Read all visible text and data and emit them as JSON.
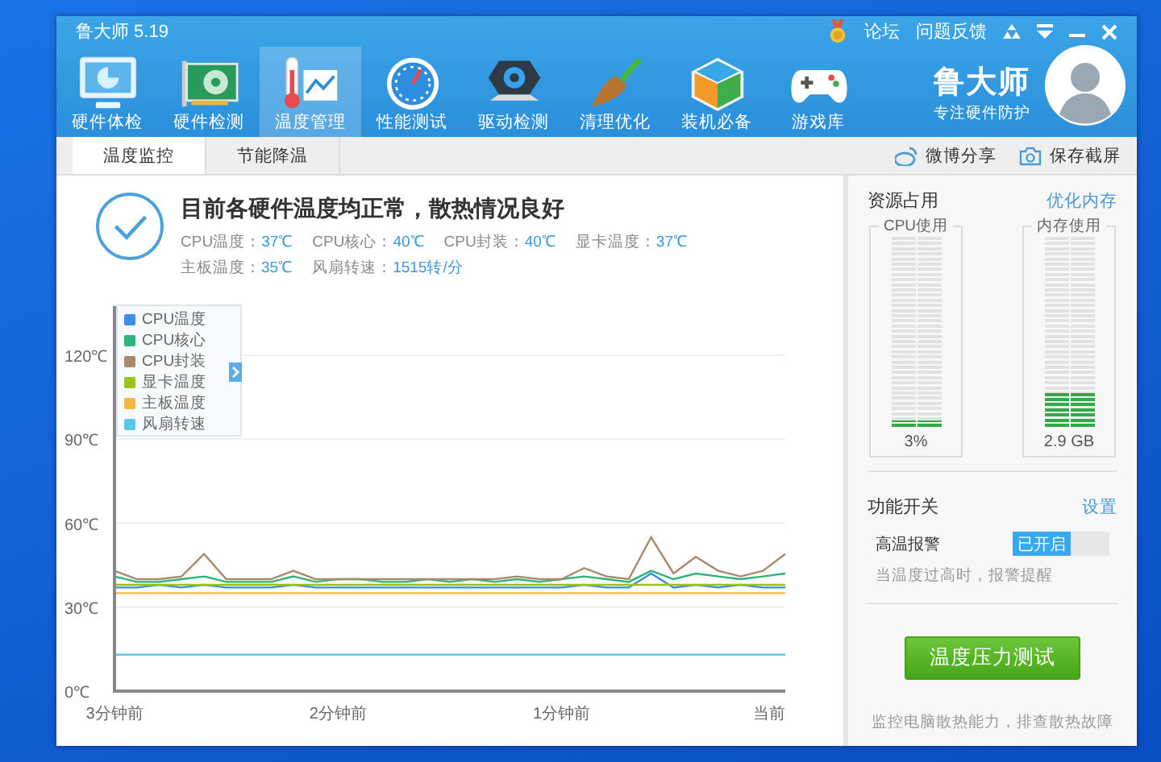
{
  "window": {
    "title": "鲁大师 5.19"
  },
  "title_bar": {
    "links": [
      "论坛",
      "问题反馈"
    ]
  },
  "nav": [
    {
      "label": "硬件体检",
      "selected": false
    },
    {
      "label": "硬件检测",
      "selected": false
    },
    {
      "label": "温度管理",
      "selected": true
    },
    {
      "label": "性能测试",
      "selected": false
    },
    {
      "label": "驱动检测",
      "selected": false
    },
    {
      "label": "清理优化",
      "selected": false
    },
    {
      "label": "装机必备",
      "selected": false
    },
    {
      "label": "游戏库",
      "selected": false
    }
  ],
  "brand": {
    "name": "鲁大师",
    "slogan": "专注硬件防护"
  },
  "subtabs": [
    {
      "label": "温度监控",
      "selected": true
    },
    {
      "label": "节能降温",
      "selected": false
    }
  ],
  "actions": [
    "微博分享",
    "保存截屏"
  ],
  "status": {
    "headline": "目前各硬件温度均正常，散热情况良好",
    "readings": [
      [
        {
          "label": "CPU温度：",
          "value": "37℃"
        },
        {
          "label": "CPU核心：",
          "value": "40℃"
        },
        {
          "label": "CPU封装：",
          "value": "40℃"
        },
        {
          "label": "显卡温度：",
          "value": "37℃"
        }
      ],
      [
        {
          "label": "主板温度：",
          "value": "35℃"
        },
        {
          "label": "风扇转速：",
          "value": "1515转/分"
        }
      ]
    ]
  },
  "chart_data": {
    "type": "line",
    "grid": true,
    "legend": "upper left",
    "x": [
      3,
      2.9,
      2.8,
      2.7,
      2.6,
      2.5,
      2.4,
      2.3,
      2.2,
      2.1,
      2,
      1.9,
      1.8,
      1.7,
      1.6,
      1.5,
      1.4,
      1.3,
      1.2,
      1.1,
      1,
      0.9,
      0.8,
      0.7,
      0.6,
      0.5,
      0.4,
      0.3,
      0.2,
      0.1,
      0
    ],
    "xlim": [
      3,
      0
    ],
    "xticks": [
      {
        "value": 3,
        "label": "3分钟前"
      },
      {
        "value": 2,
        "label": "2分钟前"
      },
      {
        "value": 1,
        "label": "1分钟前"
      },
      {
        "value": 0,
        "label": "当前"
      }
    ],
    "yticks": [
      {
        "value": 0,
        "label": "0℃"
      },
      {
        "value": 30,
        "label": "30℃"
      },
      {
        "value": 60,
        "label": "60℃"
      },
      {
        "value": 90,
        "label": "90℃"
      },
      {
        "value": 120,
        "label": "120℃"
      }
    ],
    "ylim": [
      0,
      137
    ],
    "series": [
      {
        "name": "CPU温度",
        "color": "#3a8ee6",
        "values": [
          37,
          37,
          38,
          37,
          38,
          37,
          37,
          37,
          38,
          37,
          37,
          37,
          37,
          37,
          37,
          37,
          37,
          37,
          37,
          37,
          37,
          38,
          37,
          37,
          42,
          37,
          38,
          37,
          38,
          37,
          37
        ]
      },
      {
        "name": "CPU核心",
        "color": "#2fb37a",
        "values": [
          41,
          39,
          39,
          40,
          41,
          39,
          39,
          39,
          41,
          39,
          40,
          40,
          39,
          39,
          40,
          39,
          40,
          39,
          40,
          39,
          40,
          41,
          40,
          39,
          43,
          40,
          42,
          41,
          40,
          41,
          42
        ]
      },
      {
        "name": "CPU封装",
        "color": "#a88a6a",
        "values": [
          43,
          40,
          40,
          41,
          49,
          40,
          40,
          40,
          43,
          40,
          40,
          40,
          40,
          40,
          40,
          40,
          40,
          40,
          41,
          40,
          40,
          44,
          41,
          40,
          55,
          42,
          48,
          43,
          41,
          43,
          49
        ]
      },
      {
        "name": "显卡温度",
        "color": "#9ac31c",
        "values": [
          38,
          38,
          38,
          38,
          38,
          38,
          38,
          38,
          38,
          38,
          38,
          38,
          38,
          38,
          38,
          38,
          38,
          38,
          38,
          38,
          38,
          38,
          38,
          38,
          38,
          38,
          38,
          38,
          38,
          38,
          38
        ]
      },
      {
        "name": "主板温度",
        "color": "#f5b942",
        "values": [
          35,
          35,
          35,
          35,
          35,
          35,
          35,
          35,
          35,
          35,
          35,
          35,
          35,
          35,
          35,
          35,
          35,
          35,
          35,
          35,
          35,
          35,
          35,
          35,
          35,
          35,
          35,
          35,
          35,
          35,
          35
        ]
      },
      {
        "name": "风扇转速",
        "color": "#5bc8e8",
        "values": [
          13,
          13,
          13,
          13,
          13,
          13,
          13,
          13,
          13,
          13,
          13,
          13,
          13,
          13,
          13,
          13,
          13,
          13,
          13,
          13,
          13,
          13,
          13,
          13,
          13,
          13,
          13,
          13,
          13,
          13,
          13
        ]
      }
    ]
  },
  "resources": {
    "title": "资源占用",
    "link": "优化内存",
    "meters": [
      {
        "name": "CPU使用",
        "level": 0.03,
        "reading": "3%"
      },
      {
        "name": "内存使用",
        "level": 0.18,
        "reading": "2.9 GB"
      }
    ]
  },
  "features": {
    "title": "功能开关",
    "link": "设置",
    "switches": [
      {
        "name": "高温报警",
        "on": true,
        "state_label": "已开启",
        "hint": "当温度过高时，报警提醒"
      }
    ]
  },
  "stress": {
    "button": "温度压力测试",
    "hint": "监控电脑散热能力，排查散热故障"
  }
}
